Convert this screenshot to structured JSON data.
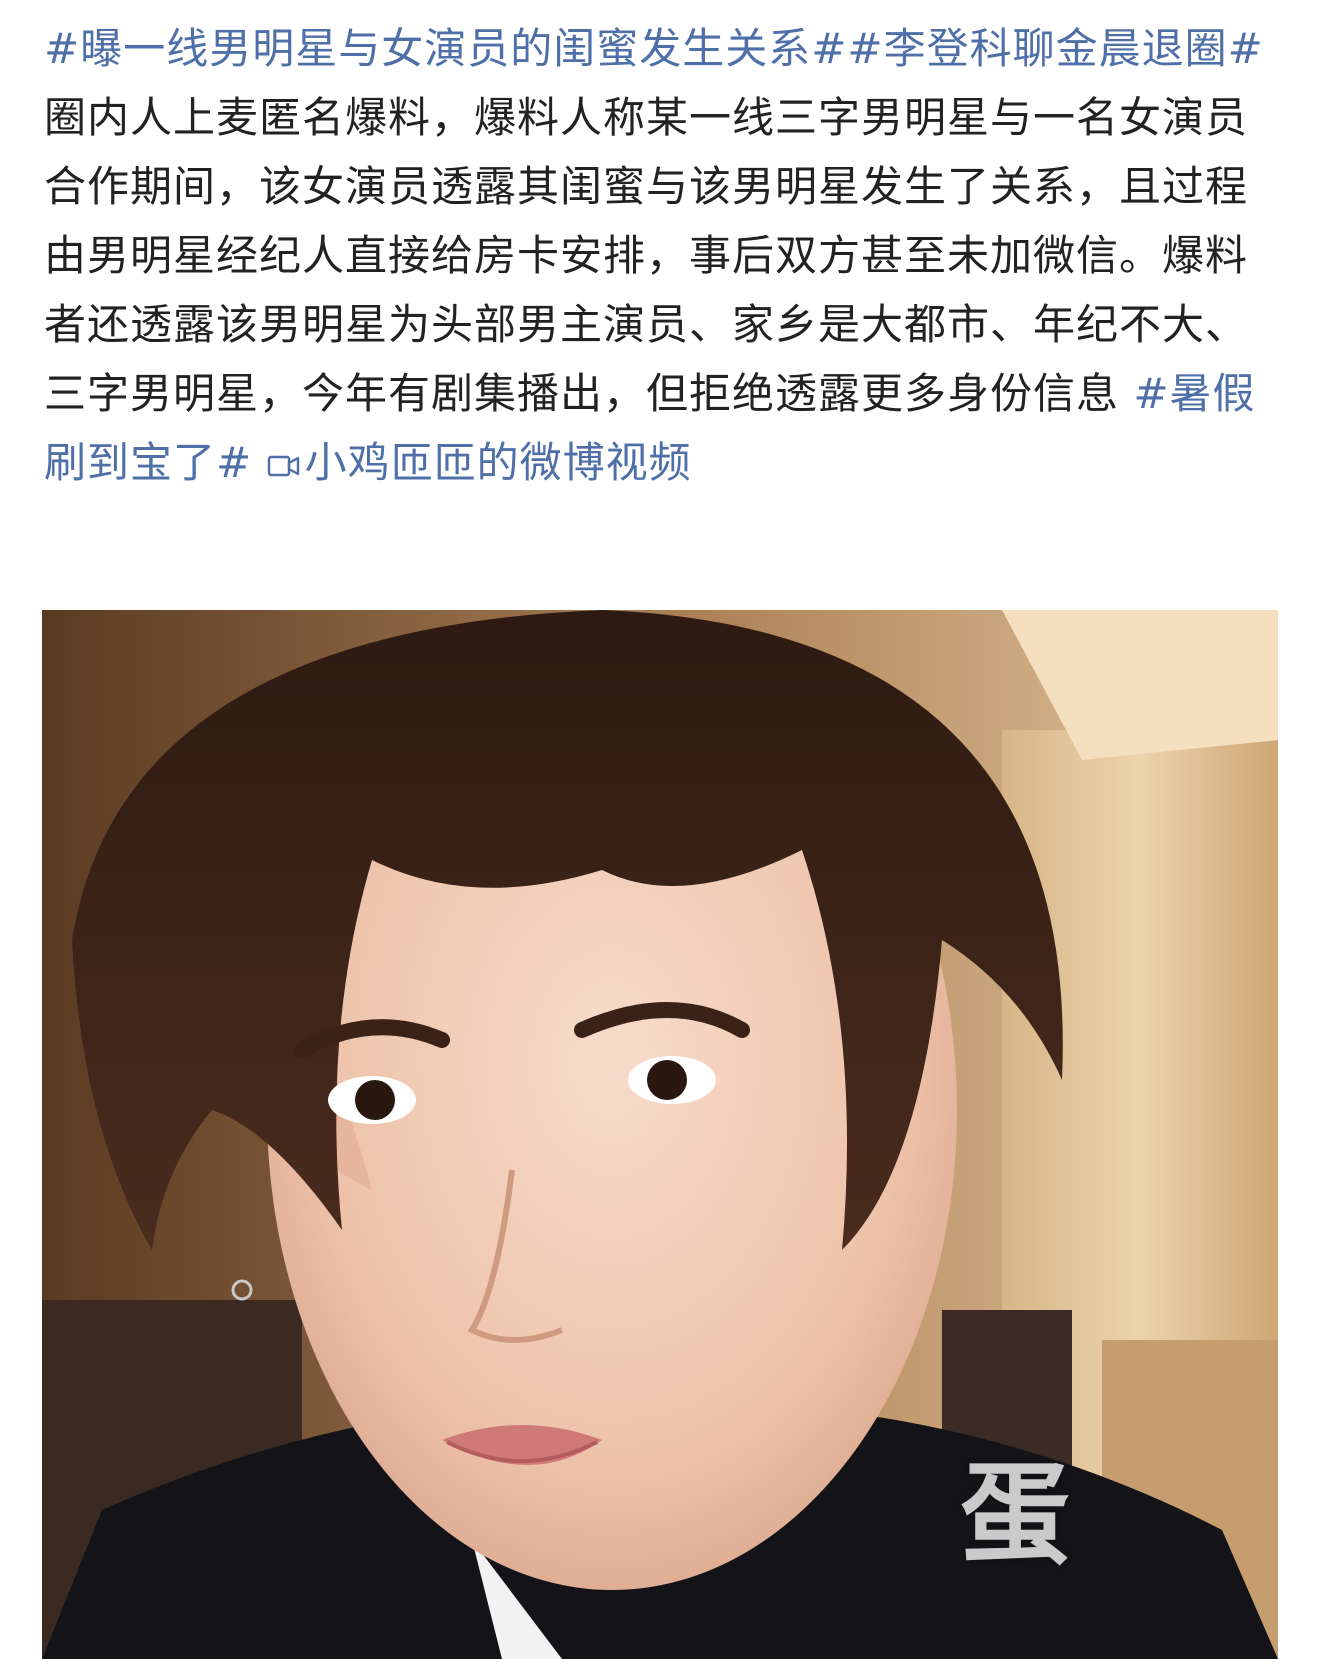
{
  "post": {
    "segments": [
      {
        "type": "topic",
        "text": "#曝一线男明星与女演员的闺蜜发生关系#"
      },
      {
        "type": "topic",
        "text": "#李登科聊金晨退圈#"
      },
      {
        "type": "text",
        "text": "圈内人上麦匿名爆料，爆料人称某一线三字男明星与一名女演员合作期间，该女演员透露其闺蜜与该男明星发生了关系，且过程由男明星经纪人直接给房卡安排，事后双方甚至未加微信。爆料者还透露该男明星为头部男主演员、家乡是大都市、年纪不大、三字男明星，今年有剧集播出，但拒绝透露更多身份信息 "
      },
      {
        "type": "topic",
        "text": "#暑假刷到宝了#"
      },
      {
        "type": "text",
        "text": " "
      },
      {
        "type": "video-link",
        "text": "小鸡匝匝的微博视频",
        "icon": "video-icon"
      }
    ]
  },
  "media": {
    "overlay_char": "蛋"
  },
  "colors": {
    "link": "#4f6fa8",
    "text": "#222222"
  }
}
